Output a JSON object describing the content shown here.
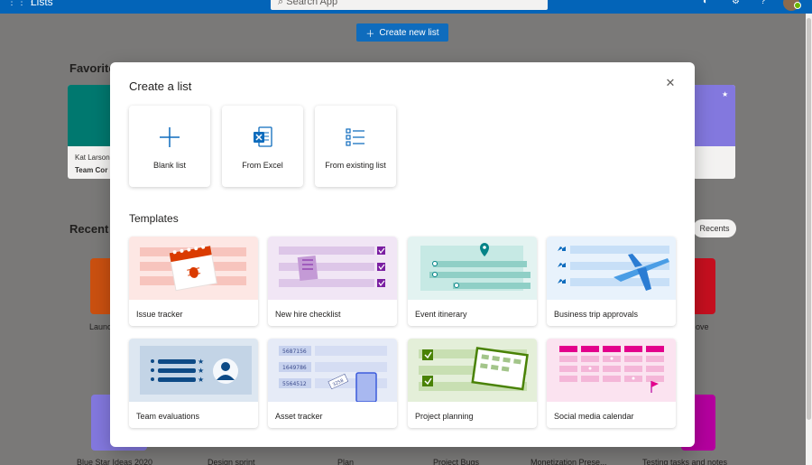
{
  "topbar": {
    "app_name": "Lists",
    "waffle_icon": "waffle-icon",
    "search_placeholder": "Search App",
    "icons": [
      "megaphone-icon",
      "gear-icon",
      "help-icon"
    ]
  },
  "background": {
    "create_button": "Create new list",
    "favorites_heading": "Favorite",
    "favorite_card": {
      "owner": "Kat Larson'",
      "title": "Team Cor"
    },
    "recent_heading": "Recent",
    "recents_chip": "Recents",
    "recent_items": [
      {
        "label": "Launc"
      },
      {
        "label": "ove"
      }
    ],
    "bottom_items": [
      "Blue Star Ideas 2020",
      "Design sprint",
      "Plan",
      "Project Bugs",
      "Monetization Prese...",
      "Testing tasks and notes"
    ]
  },
  "dialog": {
    "title": "Create a list",
    "close_icon": "close-icon",
    "options": [
      {
        "label": "Blank list",
        "icon": "plus-icon"
      },
      {
        "label": "From Excel",
        "icon": "excel-icon"
      },
      {
        "label": "From existing list",
        "icon": "list-icon"
      }
    ],
    "templates_heading": "Templates",
    "templates": [
      {
        "label": "Issue tracker"
      },
      {
        "label": "New hire checklist"
      },
      {
        "label": "Event itinerary"
      },
      {
        "label": "Business trip approvals"
      },
      {
        "label": "Team evaluations"
      },
      {
        "label": "Asset tracker",
        "art_numbers": [
          "5687156",
          "1649786",
          "5564512",
          "3258"
        ]
      },
      {
        "label": "Project planning"
      },
      {
        "label": "Social media calendar"
      }
    ]
  },
  "colors": {
    "topbar": "#0364b8",
    "accent": "#0f6cbd",
    "overlay": "#7a7978"
  }
}
